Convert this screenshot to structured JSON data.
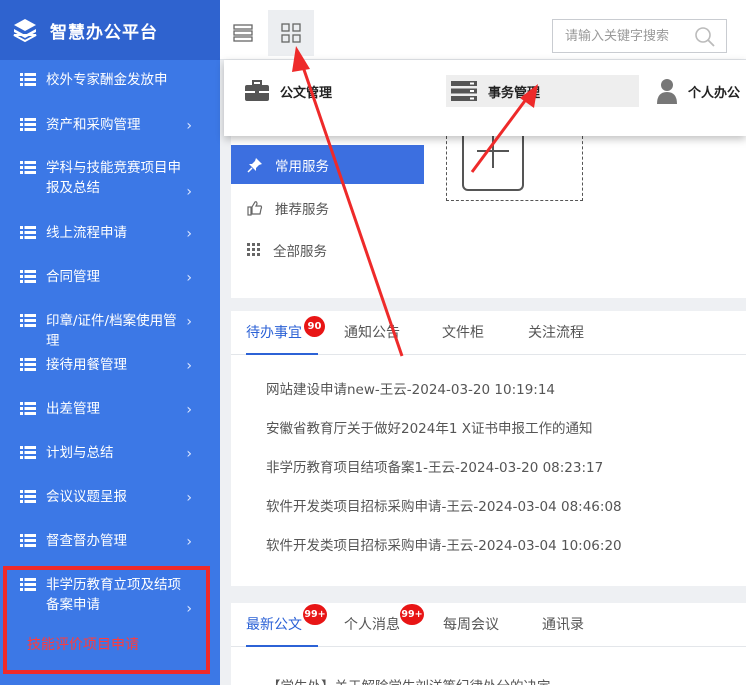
{
  "brand": {
    "title": "智慧办公平台"
  },
  "sidebar": {
    "items": [
      {
        "label": "校外专家酬金发放申",
        "chevron": false
      },
      {
        "label": "资产和采购管理",
        "chevron": true
      },
      {
        "label": "学科与技能竞赛项目申报及总结",
        "chevron": true
      },
      {
        "label": "线上流程申请",
        "chevron": true
      },
      {
        "label": "合同管理",
        "chevron": true
      },
      {
        "label": "印章/证件/档案使用管理",
        "chevron": true
      },
      {
        "label": "接待用餐管理",
        "chevron": true
      },
      {
        "label": "出差管理",
        "chevron": true
      },
      {
        "label": "计划与总结",
        "chevron": true
      },
      {
        "label": "会议议题呈报",
        "chevron": true
      },
      {
        "label": "督查督办管理",
        "chevron": true
      },
      {
        "label": "非学历教育立项及结项备案申请",
        "chevron": true
      }
    ],
    "sub_item": "技能评价项目申请"
  },
  "search": {
    "placeholder": "请输入关键字搜索"
  },
  "dropdown": {
    "items": [
      "公文管理",
      "事务管理",
      "个人办公"
    ]
  },
  "services": {
    "items": [
      "常用服务",
      "推荐服务",
      "全部服务"
    ]
  },
  "tabs1": {
    "items": [
      "待办事宜",
      "通知公告",
      "文件柜",
      "关注流程"
    ],
    "badge": "90",
    "list": [
      "网站建设申请new-王云-2024-03-20 10:19:14",
      "安徽省教育厅关于做好2024年1 X证书申报工作的通知",
      "非学历教育项目结项备案1-王云-2024-03-20 08:23:17",
      "软件开发类项目招标采购申请-王云-2024-03-04 08:46:08",
      "软件开发类项目招标采购申请-王云-2024-03-04 10:06:20"
    ]
  },
  "tabs2": {
    "items": [
      "最新公文",
      "个人消息",
      "每周会议",
      "通讯录"
    ],
    "badge1": "99+",
    "badge2": "99+",
    "first_line": "【学生处】关于解除学生刘洋等纪律处分的决定"
  },
  "colors": {
    "sidebar": "#3c78e6",
    "accent": "#2c62d6",
    "badge": "#e81515",
    "annotation": "#ee2a2a"
  }
}
